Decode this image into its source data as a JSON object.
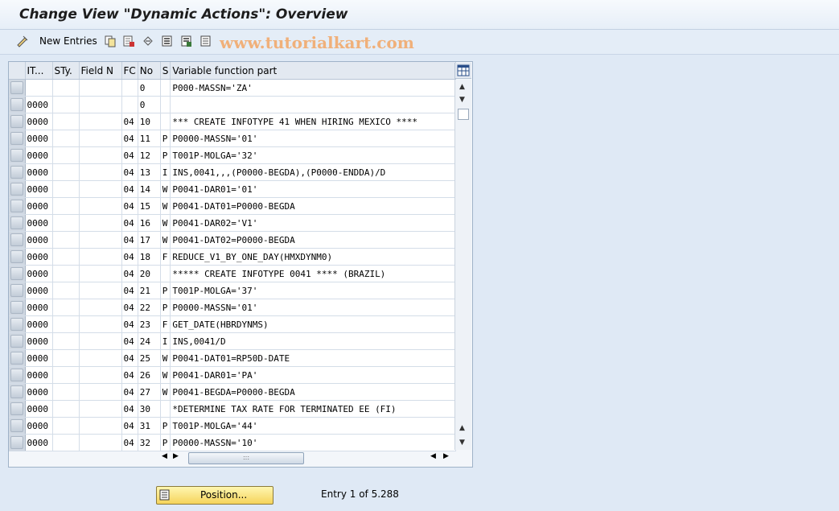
{
  "window": {
    "title": "Change View \"Dynamic Actions\": Overview"
  },
  "toolbar": {
    "new_entries_label": "New Entries",
    "watermark": "www.tutorialkart.com"
  },
  "table": {
    "columns": [
      "IT...",
      "STy.",
      "Field N",
      "FC",
      "No",
      "S",
      "Variable function part"
    ],
    "rows": [
      [
        "",
        "",
        "",
        "",
        "0",
        "",
        "P000-MASSN='ZA'"
      ],
      [
        "0000",
        "",
        "",
        "",
        "0",
        "",
        ""
      ],
      [
        "0000",
        "",
        "",
        "04",
        "10",
        "",
        "*** CREATE INFOTYPE 41 WHEN HIRING  MEXICO ****"
      ],
      [
        "0000",
        "",
        "",
        "04",
        "11",
        "P",
        "P0000-MASSN='01'"
      ],
      [
        "0000",
        "",
        "",
        "04",
        "12",
        "P",
        "T001P-MOLGA='32'"
      ],
      [
        "0000",
        "",
        "",
        "04",
        "13",
        "I",
        "INS,0041,,,(P0000-BEGDA),(P0000-ENDDA)/D"
      ],
      [
        "0000",
        "",
        "",
        "04",
        "14",
        "W",
        "P0041-DAR01='01'"
      ],
      [
        "0000",
        "",
        "",
        "04",
        "15",
        "W",
        "P0041-DAT01=P0000-BEGDA"
      ],
      [
        "0000",
        "",
        "",
        "04",
        "16",
        "W",
        "P0041-DAR02='V1'"
      ],
      [
        "0000",
        "",
        "",
        "04",
        "17",
        "W",
        "P0041-DAT02=P0000-BEGDA"
      ],
      [
        "0000",
        "",
        "",
        "04",
        "18",
        "F",
        "REDUCE_V1_BY_ONE_DAY(HMXDYNM0)"
      ],
      [
        "0000",
        "",
        "",
        "04",
        "20",
        "",
        "***** CREATE INFOTYPE 0041 **** (BRAZIL)"
      ],
      [
        "0000",
        "",
        "",
        "04",
        "21",
        "P",
        "T001P-MOLGA='37'"
      ],
      [
        "0000",
        "",
        "",
        "04",
        "22",
        "P",
        "P0000-MASSN='01'"
      ],
      [
        "0000",
        "",
        "",
        "04",
        "23",
        "F",
        "GET_DATE(HBRDYNMS)"
      ],
      [
        "0000",
        "",
        "",
        "04",
        "24",
        "I",
        "INS,0041/D"
      ],
      [
        "0000",
        "",
        "",
        "04",
        "25",
        "W",
        "P0041-DAT01=RP50D-DATE"
      ],
      [
        "0000",
        "",
        "",
        "04",
        "26",
        "W",
        "P0041-DAR01='PA'"
      ],
      [
        "0000",
        "",
        "",
        "04",
        "27",
        "W",
        "P0041-BEGDA=P0000-BEGDA"
      ],
      [
        "0000",
        "",
        "",
        "04",
        "30",
        "",
        "*DETERMINE TAX RATE FOR TERMINATED EE (FI)"
      ],
      [
        "0000",
        "",
        "",
        "04",
        "31",
        "P",
        "T001P-MOLGA='44'"
      ],
      [
        "0000",
        "",
        "",
        "04",
        "32",
        "P",
        "P0000-MASSN='10'"
      ]
    ]
  },
  "footer": {
    "position_label": "Position...",
    "entry_info": "Entry 1 of 5.288"
  }
}
